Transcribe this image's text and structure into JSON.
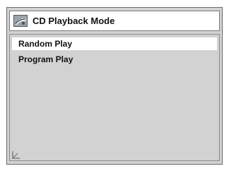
{
  "window": {
    "title": "CD Playback Mode",
    "title_icon": "cd-mode-icon"
  },
  "menu": {
    "items": [
      {
        "label": "Random Play",
        "selected": true
      },
      {
        "label": "Program Play",
        "selected": false
      }
    ]
  },
  "colors": {
    "panel_background": "#d2d2d2",
    "selected_background": "#ffffff",
    "text": "#111111",
    "border": "#6a6a6a"
  }
}
